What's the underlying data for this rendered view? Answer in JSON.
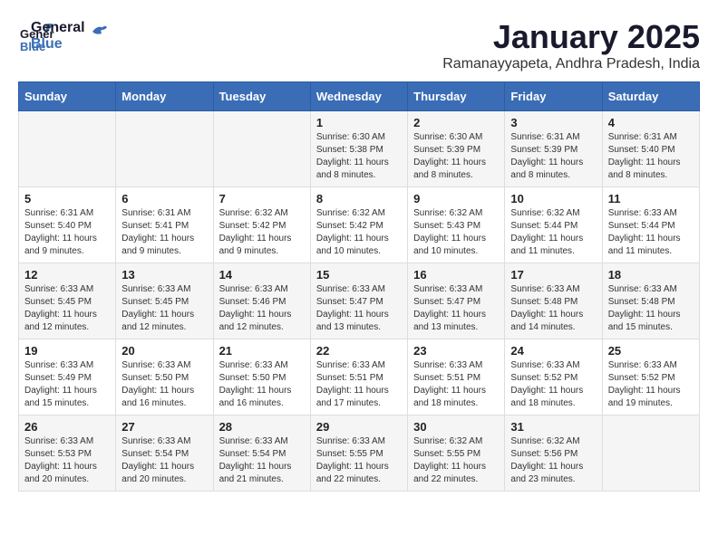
{
  "header": {
    "logo": {
      "general": "General",
      "blue": "Blue"
    },
    "title": "January 2025",
    "location": "Ramanayyapeta, Andhra Pradesh, India"
  },
  "calendar": {
    "headers": [
      "Sunday",
      "Monday",
      "Tuesday",
      "Wednesday",
      "Thursday",
      "Friday",
      "Saturday"
    ],
    "weeks": [
      [
        {
          "day": "",
          "info": ""
        },
        {
          "day": "",
          "info": ""
        },
        {
          "day": "",
          "info": ""
        },
        {
          "day": "1",
          "info": "Sunrise: 6:30 AM\nSunset: 5:38 PM\nDaylight: 11 hours and 8 minutes."
        },
        {
          "day": "2",
          "info": "Sunrise: 6:30 AM\nSunset: 5:39 PM\nDaylight: 11 hours and 8 minutes."
        },
        {
          "day": "3",
          "info": "Sunrise: 6:31 AM\nSunset: 5:39 PM\nDaylight: 11 hours and 8 minutes."
        },
        {
          "day": "4",
          "info": "Sunrise: 6:31 AM\nSunset: 5:40 PM\nDaylight: 11 hours and 8 minutes."
        }
      ],
      [
        {
          "day": "5",
          "info": "Sunrise: 6:31 AM\nSunset: 5:40 PM\nDaylight: 11 hours and 9 minutes."
        },
        {
          "day": "6",
          "info": "Sunrise: 6:31 AM\nSunset: 5:41 PM\nDaylight: 11 hours and 9 minutes."
        },
        {
          "day": "7",
          "info": "Sunrise: 6:32 AM\nSunset: 5:42 PM\nDaylight: 11 hours and 9 minutes."
        },
        {
          "day": "8",
          "info": "Sunrise: 6:32 AM\nSunset: 5:42 PM\nDaylight: 11 hours and 10 minutes."
        },
        {
          "day": "9",
          "info": "Sunrise: 6:32 AM\nSunset: 5:43 PM\nDaylight: 11 hours and 10 minutes."
        },
        {
          "day": "10",
          "info": "Sunrise: 6:32 AM\nSunset: 5:44 PM\nDaylight: 11 hours and 11 minutes."
        },
        {
          "day": "11",
          "info": "Sunrise: 6:33 AM\nSunset: 5:44 PM\nDaylight: 11 hours and 11 minutes."
        }
      ],
      [
        {
          "day": "12",
          "info": "Sunrise: 6:33 AM\nSunset: 5:45 PM\nDaylight: 11 hours and 12 minutes."
        },
        {
          "day": "13",
          "info": "Sunrise: 6:33 AM\nSunset: 5:45 PM\nDaylight: 11 hours and 12 minutes."
        },
        {
          "day": "14",
          "info": "Sunrise: 6:33 AM\nSunset: 5:46 PM\nDaylight: 11 hours and 12 minutes."
        },
        {
          "day": "15",
          "info": "Sunrise: 6:33 AM\nSunset: 5:47 PM\nDaylight: 11 hours and 13 minutes."
        },
        {
          "day": "16",
          "info": "Sunrise: 6:33 AM\nSunset: 5:47 PM\nDaylight: 11 hours and 13 minutes."
        },
        {
          "day": "17",
          "info": "Sunrise: 6:33 AM\nSunset: 5:48 PM\nDaylight: 11 hours and 14 minutes."
        },
        {
          "day": "18",
          "info": "Sunrise: 6:33 AM\nSunset: 5:48 PM\nDaylight: 11 hours and 15 minutes."
        }
      ],
      [
        {
          "day": "19",
          "info": "Sunrise: 6:33 AM\nSunset: 5:49 PM\nDaylight: 11 hours and 15 minutes."
        },
        {
          "day": "20",
          "info": "Sunrise: 6:33 AM\nSunset: 5:50 PM\nDaylight: 11 hours and 16 minutes."
        },
        {
          "day": "21",
          "info": "Sunrise: 6:33 AM\nSunset: 5:50 PM\nDaylight: 11 hours and 16 minutes."
        },
        {
          "day": "22",
          "info": "Sunrise: 6:33 AM\nSunset: 5:51 PM\nDaylight: 11 hours and 17 minutes."
        },
        {
          "day": "23",
          "info": "Sunrise: 6:33 AM\nSunset: 5:51 PM\nDaylight: 11 hours and 18 minutes."
        },
        {
          "day": "24",
          "info": "Sunrise: 6:33 AM\nSunset: 5:52 PM\nDaylight: 11 hours and 18 minutes."
        },
        {
          "day": "25",
          "info": "Sunrise: 6:33 AM\nSunset: 5:52 PM\nDaylight: 11 hours and 19 minutes."
        }
      ],
      [
        {
          "day": "26",
          "info": "Sunrise: 6:33 AM\nSunset: 5:53 PM\nDaylight: 11 hours and 20 minutes."
        },
        {
          "day": "27",
          "info": "Sunrise: 6:33 AM\nSunset: 5:54 PM\nDaylight: 11 hours and 20 minutes."
        },
        {
          "day": "28",
          "info": "Sunrise: 6:33 AM\nSunset: 5:54 PM\nDaylight: 11 hours and 21 minutes."
        },
        {
          "day": "29",
          "info": "Sunrise: 6:33 AM\nSunset: 5:55 PM\nDaylight: 11 hours and 22 minutes."
        },
        {
          "day": "30",
          "info": "Sunrise: 6:32 AM\nSunset: 5:55 PM\nDaylight: 11 hours and 22 minutes."
        },
        {
          "day": "31",
          "info": "Sunrise: 6:32 AM\nSunset: 5:56 PM\nDaylight: 11 hours and 23 minutes."
        },
        {
          "day": "",
          "info": ""
        }
      ]
    ]
  }
}
